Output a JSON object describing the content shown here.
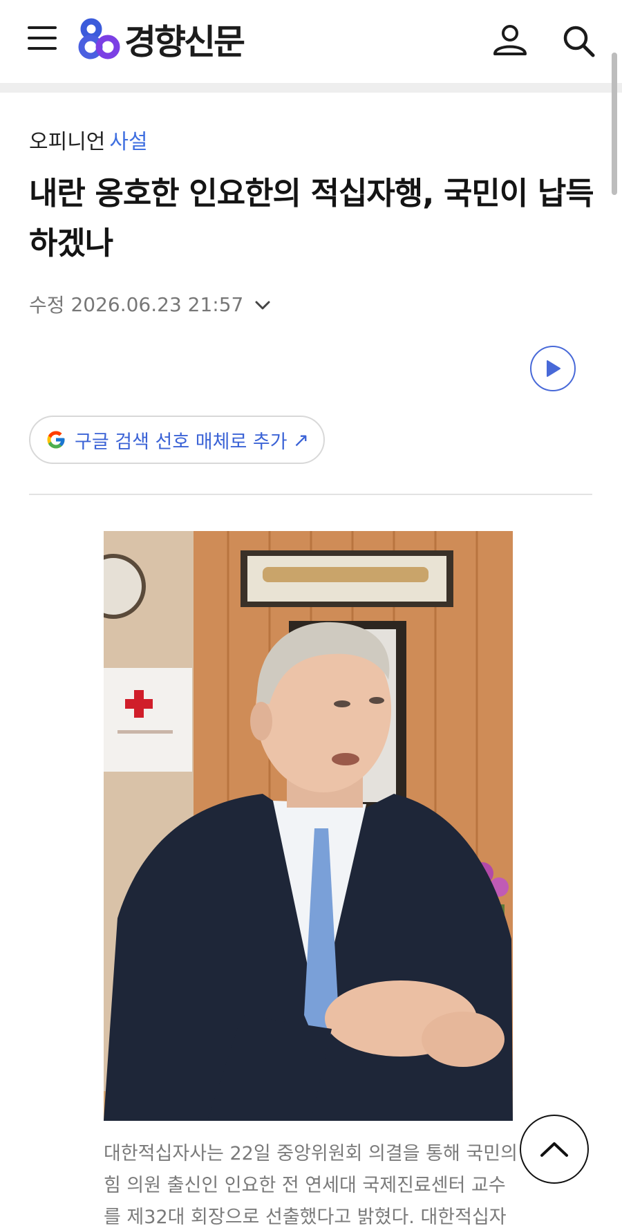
{
  "header": {
    "logo_text": "경향신문",
    "brand_colors": {
      "logo_blue": "#3b5bdb",
      "logo_purple": "#7b3fe4"
    },
    "menu_icon": "hamburger-menu-icon",
    "user_icon": "user-icon",
    "search_icon": "search-icon"
  },
  "breadcrumb": {
    "category": "오피니언",
    "section": "사설"
  },
  "article": {
    "headline": "내란 옹호한 인요한의 적십자행, 국민이 납득하겠나",
    "meta_label": "수정",
    "meta_date": "2026.06.23 21:57"
  },
  "google_pill": {
    "label": "구글 검색 선호 매체로 추가",
    "arrow": "↗",
    "icon": "google-g-icon"
  },
  "caption": "대한적십자사는 22일 중앙위원회 의결을 통해 국민의힘 의원 출신인 인요한 전 연세대 국제진료센터 교수를 제32대 회장으로 선출했다고 밝혔다. 대한적십자",
  "accent_color": "#3f6fe0"
}
